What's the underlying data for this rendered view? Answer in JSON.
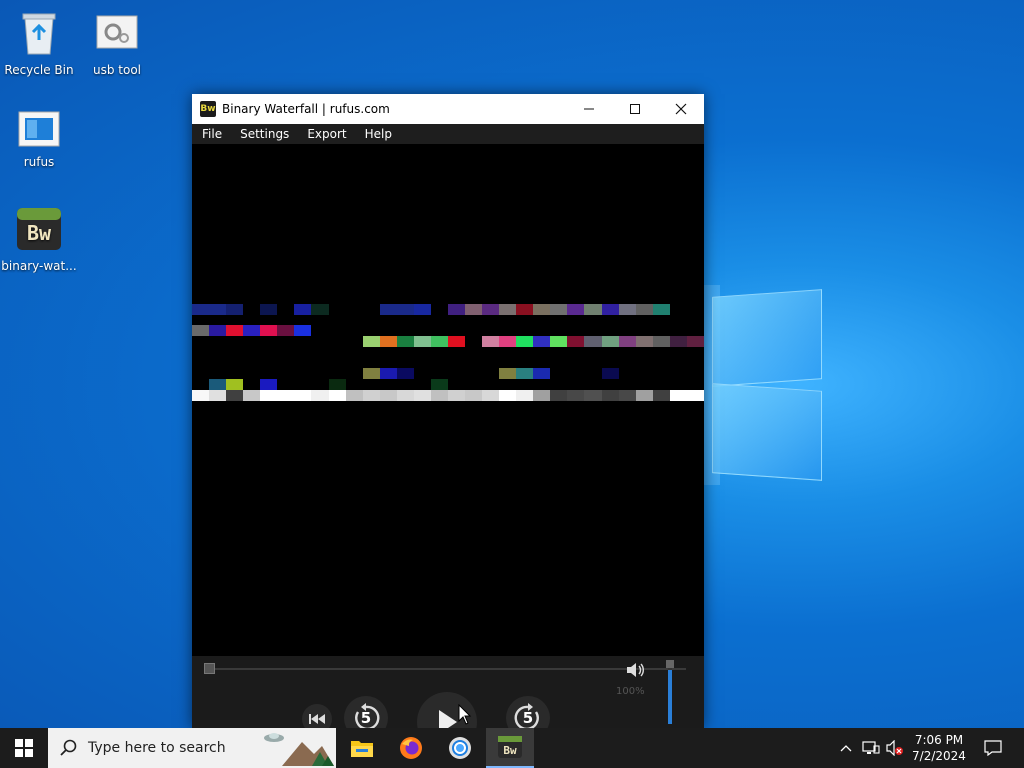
{
  "desktop": {
    "icons": [
      {
        "label": "Recycle Bin"
      },
      {
        "label": "usb tool"
      },
      {
        "label": "rufus"
      },
      {
        "label": "binary-wat..."
      }
    ]
  },
  "window": {
    "title": "Binary Waterfall | rufus.com",
    "app_icon_text": "Bw",
    "menu": [
      "File",
      "Settings",
      "Export",
      "Help"
    ],
    "controls": {
      "rewind_seconds": "5",
      "forward_seconds": "5",
      "volume_label": "100%"
    }
  },
  "taskbar": {
    "search_placeholder": "Type here to search",
    "time": "7:06 PM",
    "date": "7/2/2024"
  },
  "colors": {
    "desktop_blue": "#0b6fd0",
    "taskbar": "#1c1c1c",
    "window_black": "#000000",
    "accent": "#7fb8ff"
  }
}
